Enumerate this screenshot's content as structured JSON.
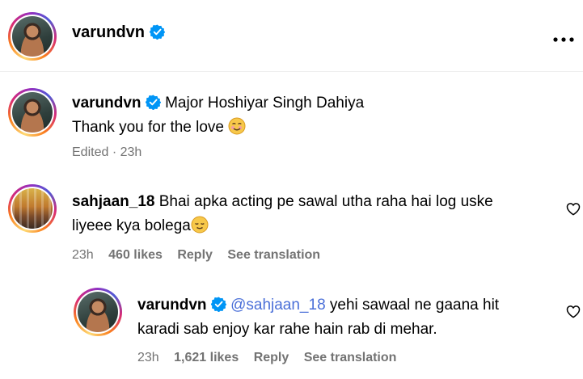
{
  "post": {
    "author": "varundvn",
    "more_icon": "more-horizontal-icon"
  },
  "caption": {
    "author": "varundvn",
    "line1": "Major Hoshiyar Singh Dahiya",
    "line2": "Thank you for the love",
    "meta": "Edited · 23h"
  },
  "comment1": {
    "author": "sahjaan_18",
    "line1": "Bhai apka acting pe sawal utha raha hai log uske",
    "line2": "liyeee kya bolega",
    "time": "23h",
    "likes": "460 likes",
    "reply": "Reply",
    "translate": "See translation"
  },
  "reply1": {
    "author": "varundvn",
    "mention": "@sahjaan_18",
    "line1": "yehi sawaal ne gaana hit",
    "line2": "karadi sab enjoy kar rahe hain rab di mehar.",
    "time": "23h",
    "likes": "1,621 likes",
    "reply": "Reply",
    "translate": "See translation"
  },
  "colors": {
    "verified": "#0095f6",
    "muted": "#737373",
    "mention": "#4a6fd8"
  }
}
